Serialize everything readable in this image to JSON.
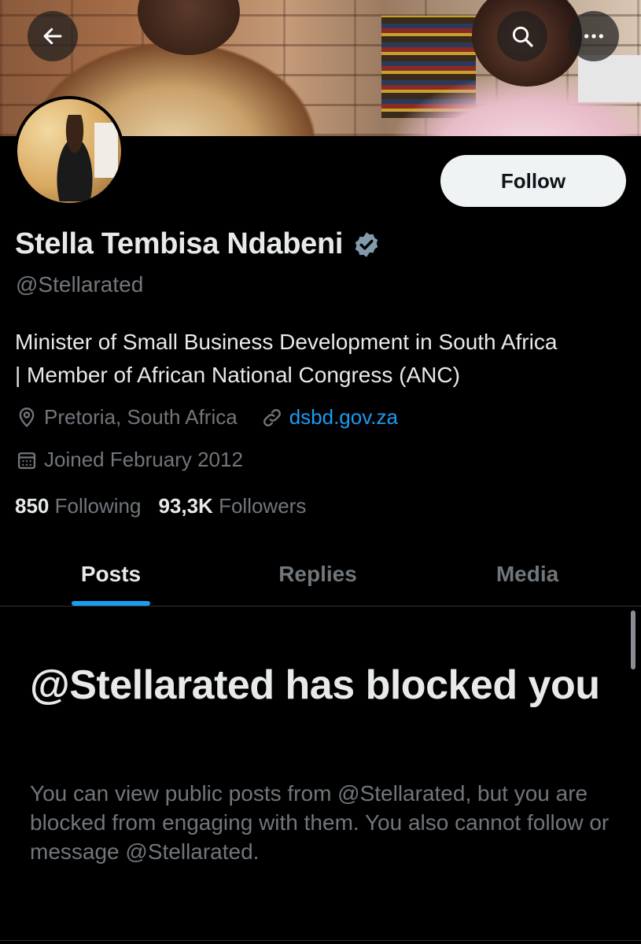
{
  "header": {
    "back_icon": "arrow-left-icon",
    "search_icon": "search-icon",
    "more_icon": "more-horizontal-icon"
  },
  "profile": {
    "display_name": "Stella Tembisa Ndabeni",
    "verified_icon": "verified-badge-icon",
    "verified_color": "#829aab",
    "handle": "@Stellarated",
    "follow_label": "Follow",
    "bio_line1": "Minister of Small Business Development in South Africa",
    "bio_line2": "| Member of African National Congress (ANC)",
    "location": "Pretoria, South Africa",
    "website": "dsbd.gov.za",
    "joined": "Joined February 2012",
    "following_count": "850",
    "following_label": "Following",
    "followers_count": "93,3K",
    "followers_label": "Followers"
  },
  "tabs": [
    {
      "label": "Posts",
      "active": true
    },
    {
      "label": "Replies",
      "active": false
    },
    {
      "label": "Media",
      "active": false
    }
  ],
  "blocked": {
    "title": "@Stellarated has blocked you",
    "message": "You can view public posts from @Stellarated, but you are blocked from engaging with them. You also cannot follow or message @Stellarated."
  },
  "colors": {
    "background": "#000000",
    "text_primary": "#e7e9ea",
    "text_secondary": "#71767b",
    "accent": "#1d9bf0"
  }
}
